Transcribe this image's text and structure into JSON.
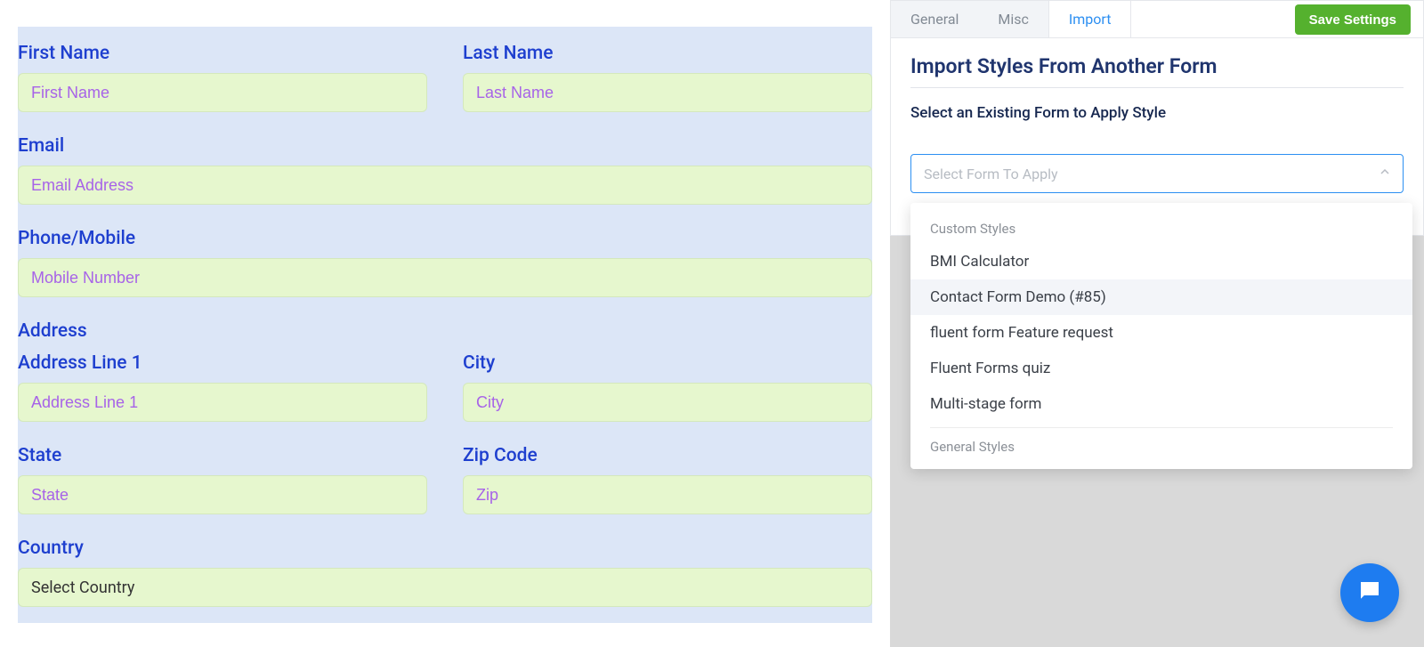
{
  "form": {
    "first_name_label": "First Name",
    "first_name_ph": "First Name",
    "last_name_label": "Last Name",
    "last_name_ph": "Last Name",
    "email_label": "Email",
    "email_ph": "Email Address",
    "phone_label": "Phone/Mobile",
    "phone_ph": "Mobile Number",
    "address_label": "Address",
    "addr1_label": "Address Line 1",
    "addr1_ph": "Address Line 1",
    "city_label": "City",
    "city_ph": "City",
    "state_label": "State",
    "state_ph": "State",
    "zip_label": "Zip Code",
    "zip_ph": "Zip",
    "country_label": "Country",
    "country_select": "Select Country"
  },
  "tabs": {
    "general": "General",
    "misc": "Misc",
    "import": "Import"
  },
  "save_btn": "Save Settings",
  "panel": {
    "title": "Import Styles From Another Form",
    "subtitle": "Select an Existing Form to Apply Style",
    "placeholder": "Select Form To Apply"
  },
  "dropdown": {
    "group1": "Custom Styles",
    "opts1": {
      "o1": "BMI Calculator",
      "o2": "Contact Form Demo (#85)",
      "o3": "fluent form Feature request",
      "o4": "Fluent Forms quiz",
      "o5": "Multi-stage form"
    },
    "group2": "General Styles"
  }
}
